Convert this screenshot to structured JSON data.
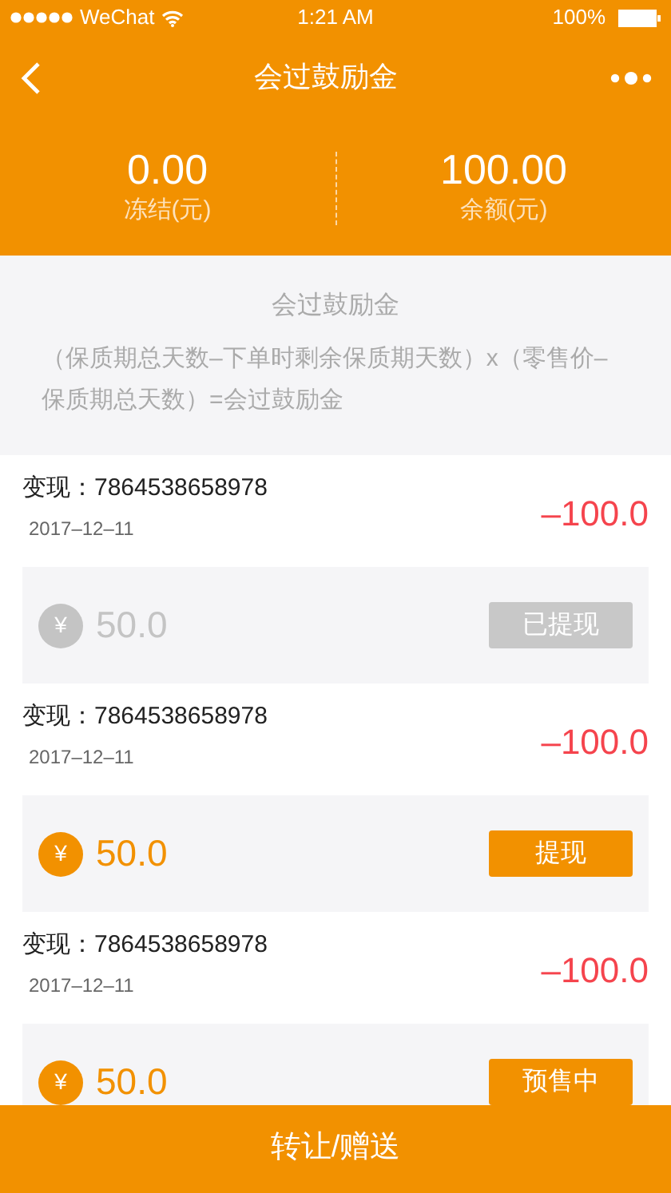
{
  "status_bar": {
    "carrier": "WeChat",
    "time": "1:21 AM",
    "battery": "100%"
  },
  "nav": {
    "title": "会过鼓励金"
  },
  "stats": [
    {
      "value": "0.00",
      "label": "冻结(元)"
    },
    {
      "value": "100.00",
      "label": "余额(元)"
    }
  ],
  "info": {
    "title": "会过鼓励金",
    "formula": "（保质期总天数–下单时剩余保质期天数）x（零售价–保质期总天数）=会过鼓励金"
  },
  "records": [
    {
      "title": "变现：7864538658978",
      "date": "2017–12–11",
      "amount": "–100.0",
      "currency": "¥",
      "value": "50.0",
      "button": "已提现",
      "disabled": true
    },
    {
      "title": "变现：7864538658978",
      "date": "2017–12–11",
      "amount": "–100.0",
      "currency": "¥",
      "value": "50.0",
      "button": "提现",
      "disabled": false
    },
    {
      "title": "变现：7864538658978",
      "date": "2017–12–11",
      "amount": "–100.0",
      "currency": "¥",
      "value": "50.0",
      "button": "预售中",
      "disabled": false
    }
  ],
  "bottom_button": "转让/赠送"
}
